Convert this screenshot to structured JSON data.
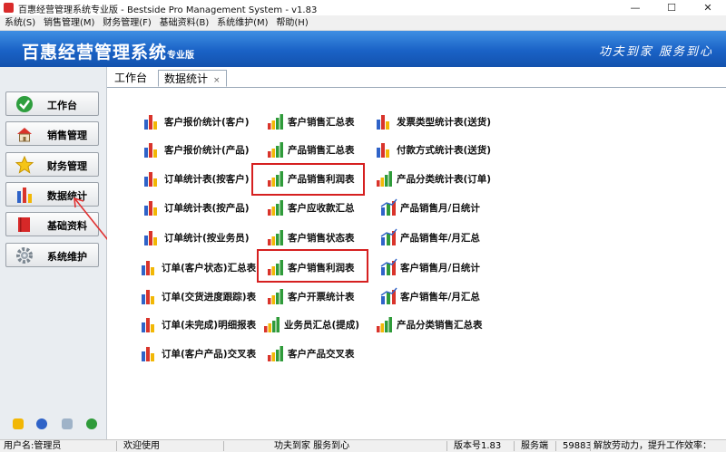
{
  "window": {
    "title": "百惠经营管理系统专业版 - Bestside Pro Management System - v1.83",
    "minimize_glyph": "—",
    "maximize_glyph": "☐",
    "close_glyph": "✕"
  },
  "menu": [
    "系统(S)",
    "销售管理(M)",
    "财务管理(F)",
    "基础资料(B)",
    "系统维护(M)",
    "帮助(H)"
  ],
  "banner": {
    "brand": "百惠经营管理系统",
    "edition": "专业版",
    "slogan": "功夫到家 服务到心"
  },
  "sidebar": {
    "items": [
      {
        "label": "工作台",
        "icon": "check-icon"
      },
      {
        "label": "销售管理",
        "icon": "house-icon"
      },
      {
        "label": "财务管理",
        "icon": "star-icon"
      },
      {
        "label": "数据统计",
        "icon": "bar-chart-icon"
      },
      {
        "label": "基础资料",
        "icon": "book-icon"
      },
      {
        "label": "系统维护",
        "icon": "gear-icon"
      }
    ],
    "bottom_icons": [
      "edit-icon",
      "info-icon",
      "search-icon",
      "back-icon"
    ]
  },
  "tabs": [
    {
      "label": "工作台"
    },
    {
      "label": "数据统计",
      "close": "×"
    }
  ],
  "reports": {
    "col1": [
      "客户报价统计(客户)",
      "客户报价统计(产品)",
      "订单统计表(按客户)",
      "订单统计表(按产品)",
      "订单统计(按业务员)",
      "订单(客户状态)汇总表",
      "订单(交货进度跟踪)表",
      "订单(未完成)明细报表",
      "订单(客户产品)交叉表"
    ],
    "col2": [
      "客户销售汇总表",
      "产品销售汇总表",
      "产品销售利润表",
      "客户应收款汇总",
      "客户销售状态表",
      "客户销售利润表",
      "客户开票统计表",
      "业务员汇总(提成)",
      "客户产品交叉表"
    ],
    "col3": [
      "发票类型统计表(送货)",
      "付款方式统计表(送货)",
      "产品分类统计表(订单)",
      "产品销售月/日统计",
      "产品销售年/月汇总",
      "客户销售月/日统计",
      "客户销售年/月汇总",
      "产品分类销售汇总表"
    ]
  },
  "statusbar": {
    "user": "用户名:管理员",
    "welcome": "欢迎使用",
    "slogan": "功夫到家 服务到心",
    "version": "版本号1.83",
    "server": "服务端",
    "code": "59883",
    "tagline": "解放劳动力，提升工作效率："
  },
  "colors": {
    "banner": "#1a62c6",
    "highlight": "#d62020",
    "chart_red": "#d9342b",
    "chart_green": "#2f9b3a",
    "chart_blue": "#2f63c8",
    "chart_yellow": "#f2b705"
  }
}
